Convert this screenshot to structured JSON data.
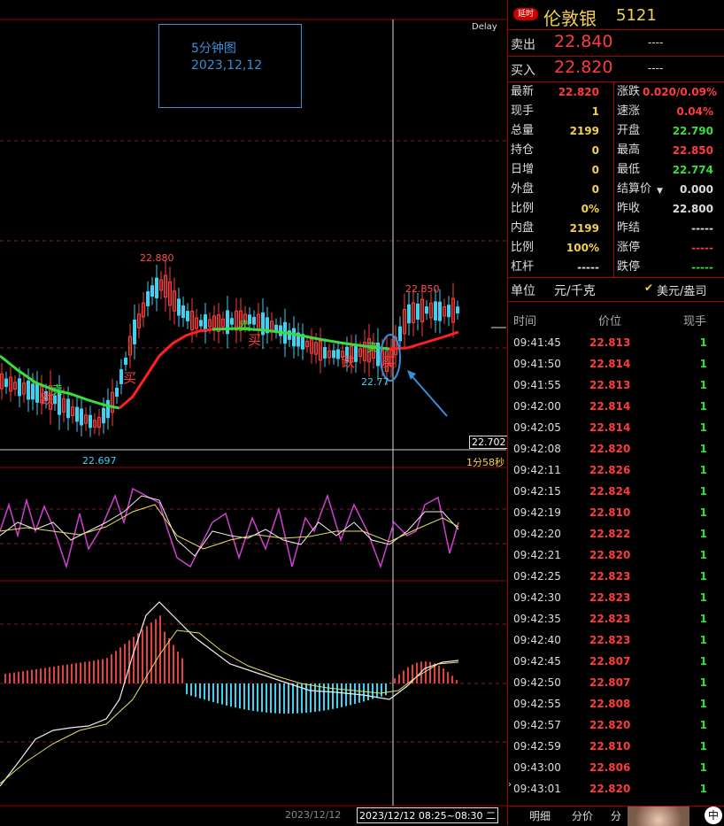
{
  "chart": {
    "delay_label": "Delay",
    "note_title": "5分钟图",
    "note_date": "2023,12,12",
    "high_label": "22.880",
    "low_label": "22.697",
    "mid_label": "22.850",
    "mid_low_label": "22.77",
    "last_price_box": "22.702",
    "countdown": "1分58秒",
    "axis_date": "2023/12/12",
    "axis_range": "2023/12/12 08:25~08:30 二",
    "buy_mark": "买",
    "sell_mark": "卖",
    "dip_mark": "跌"
  },
  "panel": {
    "badge": "延时",
    "title": "伦敦银",
    "code": "5121",
    "sell_label": "卖出",
    "sell_price": "22.840",
    "sell_vol": "----",
    "buy_label": "买入",
    "buy_price": "22.820",
    "buy_vol": "----",
    "left_stats": [
      {
        "label": "最新",
        "value": "22.820",
        "color": "#ff3c3c"
      },
      {
        "label": "现手",
        "value": "1",
        "color": "#f3d24a"
      },
      {
        "label": "总量",
        "value": "2199",
        "color": "#f3d24a"
      },
      {
        "label": "持仓",
        "value": "0",
        "color": "#f3d24a"
      },
      {
        "label": "日增",
        "value": "0",
        "color": "#f3d24a"
      },
      {
        "label": "外盘",
        "value": "0",
        "color": "#f3d24a"
      },
      {
        "label": "比例",
        "value": "0%",
        "color": "#f3d24a"
      },
      {
        "label": "内盘",
        "value": "2199",
        "color": "#f3d24a"
      },
      {
        "label": "比例",
        "value": "100%",
        "color": "#f3d24a"
      },
      {
        "label": "杠杆",
        "value": "-----",
        "color": "#ddd"
      }
    ],
    "right_stats": [
      {
        "label": "涨跌",
        "value": "0.020/0.09%",
        "color": "#ff3c3c"
      },
      {
        "label": "速涨",
        "value": "0.04%",
        "color": "#ff3c3c"
      },
      {
        "label": "开盘",
        "value": "22.790",
        "color": "#3cdc3c"
      },
      {
        "label": "最高",
        "value": "22.850",
        "color": "#ff3c3c"
      },
      {
        "label": "最低",
        "value": "22.774",
        "color": "#3cdc3c"
      },
      {
        "label": "结算价",
        "value": "0.000",
        "color": "#ddd"
      },
      {
        "label": "昨收",
        "value": "22.800",
        "color": "#ddd"
      },
      {
        "label": "昨结",
        "value": "-----",
        "color": "#ddd"
      },
      {
        "label": "涨停",
        "value": "-----",
        "color": "#ff3c3c"
      },
      {
        "label": "跌停",
        "value": "-----",
        "color": "#3cdc3c"
      }
    ],
    "unit_label": "单位",
    "unit_value": "元/千克",
    "currency_option": "美元/盎司",
    "ticks_header": {
      "time": "时间",
      "price": "价位",
      "vol": "现手"
    },
    "ticks": [
      {
        "time": "09:41:45",
        "price": "22.813",
        "vol": "1"
      },
      {
        "time": "09:41:50",
        "price": "22.814",
        "vol": "1"
      },
      {
        "time": "09:41:55",
        "price": "22.813",
        "vol": "1"
      },
      {
        "time": "09:42:00",
        "price": "22.814",
        "vol": "1"
      },
      {
        "time": "09:42:05",
        "price": "22.814",
        "vol": "1"
      },
      {
        "time": "09:42:08",
        "price": "22.820",
        "vol": "1"
      },
      {
        "time": "09:42:11",
        "price": "22.826",
        "vol": "1"
      },
      {
        "time": "09:42:15",
        "price": "22.824",
        "vol": "1"
      },
      {
        "time": "09:42:19",
        "price": "22.810",
        "vol": "1"
      },
      {
        "time": "09:42:20",
        "price": "22.822",
        "vol": "1"
      },
      {
        "time": "09:42:21",
        "price": "22.820",
        "vol": "1"
      },
      {
        "time": "09:42:25",
        "price": "22.823",
        "vol": "1"
      },
      {
        "time": "09:42:30",
        "price": "22.823",
        "vol": "1"
      },
      {
        "time": "09:42:35",
        "price": "22.823",
        "vol": "1"
      },
      {
        "time": "09:42:40",
        "price": "22.823",
        "vol": "1"
      },
      {
        "time": "09:42:45",
        "price": "22.807",
        "vol": "1"
      },
      {
        "time": "09:42:50",
        "price": "22.807",
        "vol": "1"
      },
      {
        "time": "09:42:55",
        "price": "22.808",
        "vol": "1"
      },
      {
        "time": "09:42:57",
        "price": "22.820",
        "vol": "1"
      },
      {
        "time": "09:42:59",
        "price": "22.810",
        "vol": "1"
      },
      {
        "time": "09:43:00",
        "price": "22.806",
        "vol": "1"
      },
      {
        "time": "09:43:01",
        "price": "22.820",
        "vol": "1"
      }
    ],
    "tabs": [
      "明细",
      "分价",
      "分",
      "中"
    ]
  }
}
